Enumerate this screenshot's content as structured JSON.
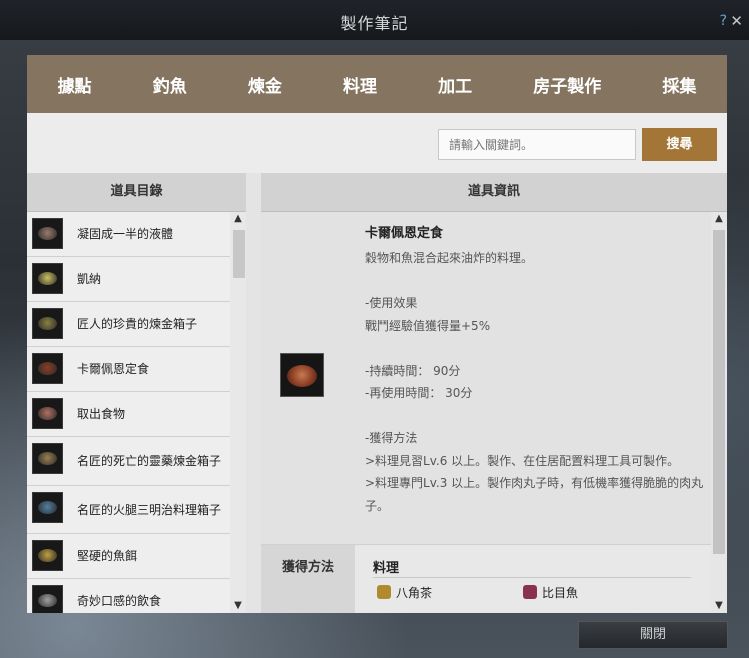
{
  "window": {
    "title": "製作筆記",
    "help_label": "?",
    "close_label": "✕"
  },
  "tabs": [
    "據點",
    "釣魚",
    "煉金",
    "料理",
    "加工",
    "房子製作",
    "採集"
  ],
  "search": {
    "placeholder": "請輸入關鍵詞。",
    "button_label": "搜尋"
  },
  "list_panel": {
    "title": "道具目錄",
    "items": [
      {
        "label": "凝固成一半的液體",
        "icon": "stew-icon",
        "color": "#9a7a6a"
      },
      {
        "label": "凱納",
        "icon": "cheese-bowl-icon",
        "color": "#c9c060"
      },
      {
        "label": "匠人的珍貴的煉金箱子",
        "icon": "alchemy-box-icon",
        "color": "#8a8040"
      },
      {
        "label": "卡爾佩恩定食",
        "icon": "fried-food-icon",
        "color": "#8b3e25"
      },
      {
        "label": "取出食物",
        "icon": "dish-icon",
        "color": "#b07060"
      },
      {
        "label": "名匠的死亡的靈藥煉金箱子",
        "icon": "elixir-box-icon",
        "color": "#9a8050"
      },
      {
        "label": "名匠的火腿三明治料理箱子",
        "icon": "sandwich-box-icon",
        "color": "#5080a0"
      },
      {
        "label": "堅硬的魚餌",
        "icon": "fish-bait-icon",
        "color": "#c0a040"
      },
      {
        "label": "奇妙口感的飲食",
        "icon": "meal-icon",
        "color": "#a0a0a0"
      }
    ],
    "scroll_up": "▲",
    "scroll_down": "▼"
  },
  "info_panel": {
    "title": "道具資訊",
    "item_name": "卡爾佩恩定食",
    "lines": [
      "穀物和魚混合起來油炸的料理。",
      "",
      "-使用效果",
      "戰鬥經驗值獲得量+5%",
      "",
      "-持續時間： 90分",
      "-再使用時間： 30分",
      "",
      "-獲得方法",
      ">料理見習Lv.6 以上。製作、在住居配置料理工具可製作。",
      ">料理專門Lv.3 以上。製作肉丸子時，有低機率獲得脆脆的肉丸子。"
    ],
    "acquisition": {
      "label": "獲得方法",
      "category": "料理",
      "ingredients": [
        "八角茶",
        "比目魚"
      ]
    }
  },
  "close_button": "關閉"
}
